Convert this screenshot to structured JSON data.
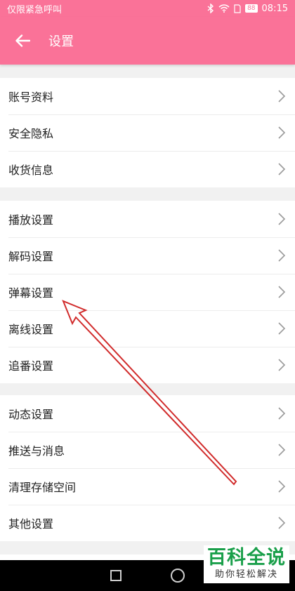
{
  "status_bar": {
    "carrier": "仅限紧急呼叫",
    "battery": "88",
    "time": "08:15"
  },
  "header": {
    "title": "设置"
  },
  "groups": [
    {
      "items": [
        {
          "label": "账号资料"
        },
        {
          "label": "安全隐私"
        },
        {
          "label": "收货信息"
        }
      ]
    },
    {
      "items": [
        {
          "label": "播放设置"
        },
        {
          "label": "解码设置"
        },
        {
          "label": "弹幕设置"
        },
        {
          "label": "离线设置"
        },
        {
          "label": "追番设置"
        }
      ]
    },
    {
      "items": [
        {
          "label": "动态设置"
        },
        {
          "label": "推送与消息"
        },
        {
          "label": "清理存储空间"
        },
        {
          "label": "其他设置"
        }
      ]
    }
  ],
  "annotation": {
    "color": "#d12b2b",
    "target": "弹幕设置"
  },
  "watermark": {
    "title": "百科全说",
    "subtitle": "助你轻松解决"
  },
  "colors": {
    "accent": "#fa7298",
    "watermark_green": "#1a9f4a"
  },
  "icons": {
    "back": "arrow-left-icon",
    "chevron": "chevron-right-icon",
    "nav_recents": "square-icon",
    "nav_home": "circle-icon"
  }
}
